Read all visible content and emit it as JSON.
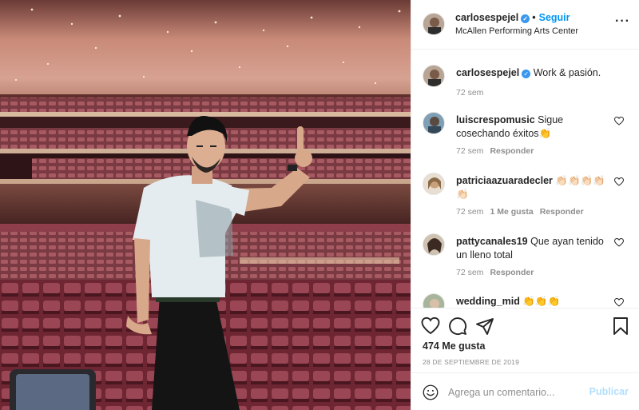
{
  "post": {
    "username": "carlosespejel",
    "verified": true,
    "follow_label": "Seguir",
    "location": "McAllen Performing Arts Center",
    "caption": "Work & pasión.",
    "caption_time": "72 sem"
  },
  "comments": [
    {
      "user": "luiscrespomusic",
      "text": "Sigue cosechando éxitos👏",
      "time": "72 sem",
      "likes": "",
      "reply_label": "Responder"
    },
    {
      "user": "patriciaazuaradecler",
      "text": "👏🏻👏🏻👏🏻👏🏻👏🏻",
      "time": "72 sem",
      "likes": "1 Me gusta",
      "reply_label": "Responder"
    },
    {
      "user": "pattycanales19",
      "text": "Que ayan tenido un lleno total",
      "time": "72 sem",
      "likes": "",
      "reply_label": "Responder"
    },
    {
      "user": "wedding_mid",
      "text": "👏👏👏",
      "time": "",
      "likes": "",
      "reply_label": ""
    }
  ],
  "actions": {
    "likes_count": "474 Me gusta",
    "date": "28 DE SEPTIEMBRE DE 2019",
    "comment_placeholder": "Agrega un comentario...",
    "publish_label": "Publicar"
  },
  "icons": {
    "like": "heart-icon",
    "comment": "comment-icon",
    "share": "share-icon",
    "save": "bookmark-icon",
    "more": "more-options-icon",
    "emoji": "emoji-icon"
  },
  "colors": {
    "link_blue": "#0095f6",
    "verified_blue": "#3897f0",
    "muted_text": "#8e8e8e",
    "publish_disabled": "#b2dffc",
    "divider": "#efefef"
  }
}
